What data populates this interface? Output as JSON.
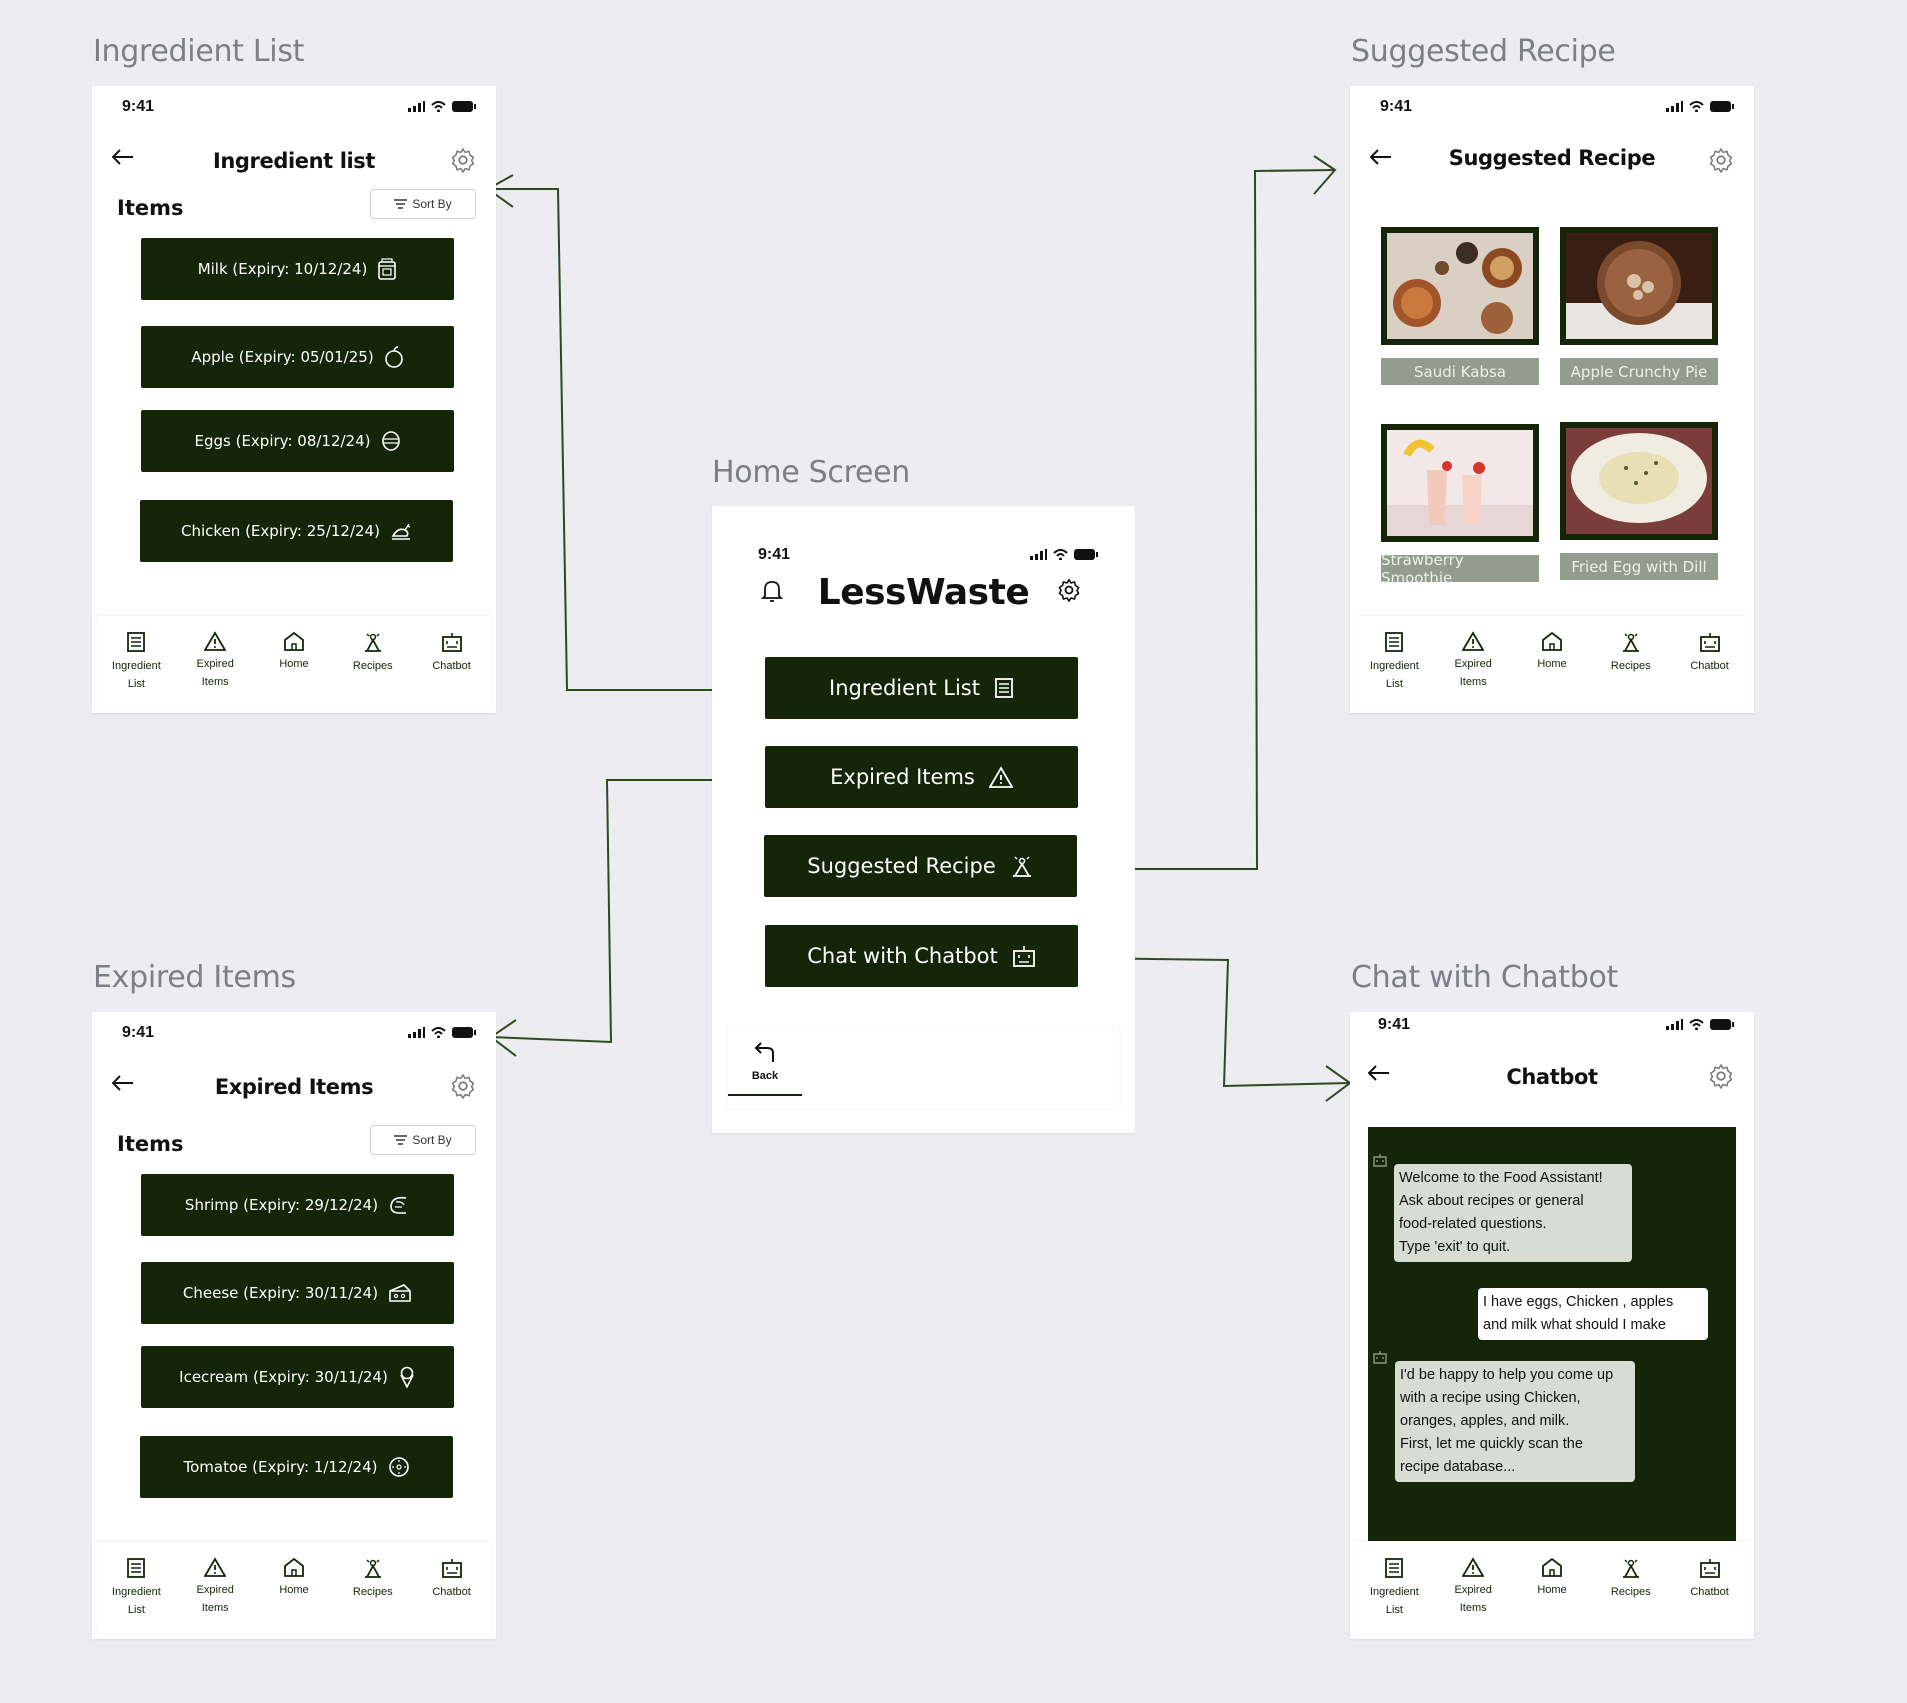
{
  "labels": {
    "ingredient_list": "Ingredient List",
    "suggested_recipe": "Suggested Recipe",
    "home_screen": "Home Screen",
    "expired_items": "Expired Items",
    "chat_with_chatbot": "Chat with Chatbot"
  },
  "status_time": "9:41",
  "tabs": {
    "ingredient": "Ingredient\nList",
    "expired": "Expired\nItems",
    "home": "Home",
    "recipes": "Recipes",
    "chatbot": "Chatbot"
  },
  "ingredient_screen": {
    "title": "Ingredient list",
    "items_heading": "Items",
    "sort_label": "Sort By",
    "items": [
      {
        "label": "Milk (Expiry: 10/12/24)",
        "icon": "milk-icon"
      },
      {
        "label": "Apple (Expiry: 05/01/25)",
        "icon": "apple-icon"
      },
      {
        "label": "Eggs (Expiry: 08/12/24)",
        "icon": "egg-icon"
      },
      {
        "label": "Chicken (Expiry: 25/12/24)",
        "icon": "chicken-icon"
      }
    ]
  },
  "expired_screen": {
    "title": "Expired Items",
    "items_heading": "Items",
    "sort_label": "Sort By",
    "items": [
      {
        "label": "Shrimp (Expiry: 29/12/24)",
        "icon": "shrimp-icon"
      },
      {
        "label": "Cheese (Expiry: 30/11/24)",
        "icon": "cheese-icon"
      },
      {
        "label": "Icecream (Expiry: 30/11/24)",
        "icon": "icecream-icon"
      },
      {
        "label": "Tomatoe (Expiry: 1/12/24)",
        "icon": "tomato-icon"
      }
    ]
  },
  "home": {
    "app_title": "LessWaste",
    "buttons": [
      {
        "label": "Ingredient List",
        "icon": "list-icon"
      },
      {
        "label": "Expired Items",
        "icon": "warning-icon"
      },
      {
        "label": "Suggested Recipe",
        "icon": "chef-icon"
      },
      {
        "label": "Chat with Chatbot",
        "icon": "robot-icon"
      }
    ],
    "back_label": "Back"
  },
  "recipe_screen": {
    "title": "Suggested Recipe",
    "recipes": [
      {
        "name": "Saudi Kabsa"
      },
      {
        "name": "Apple Crunchy Pie"
      },
      {
        "name": "Strawberry Smoothie"
      },
      {
        "name": "Fried Egg with Dill"
      }
    ]
  },
  "chat_screen": {
    "title": "Chatbot",
    "messages": [
      {
        "from": "bot",
        "text": "Welcome to the Food Assistant!\nAsk about recipes or general\nfood-related questions.\nType 'exit' to quit."
      },
      {
        "from": "user",
        "text": "I have eggs, Chicken , apples\nand milk what should I make"
      },
      {
        "from": "bot",
        "text": "I'd be happy to help you come up\nwith a recipe using Chicken,\noranges, apples, and milk.\n First, let me quickly scan the\nrecipe database..."
      }
    ]
  },
  "colors": {
    "primary": "#142508",
    "background": "#ececf1",
    "label_grey": "#7d7f88",
    "connector": "#2f4a1e",
    "recipe_label_bg": "#929d8e"
  }
}
